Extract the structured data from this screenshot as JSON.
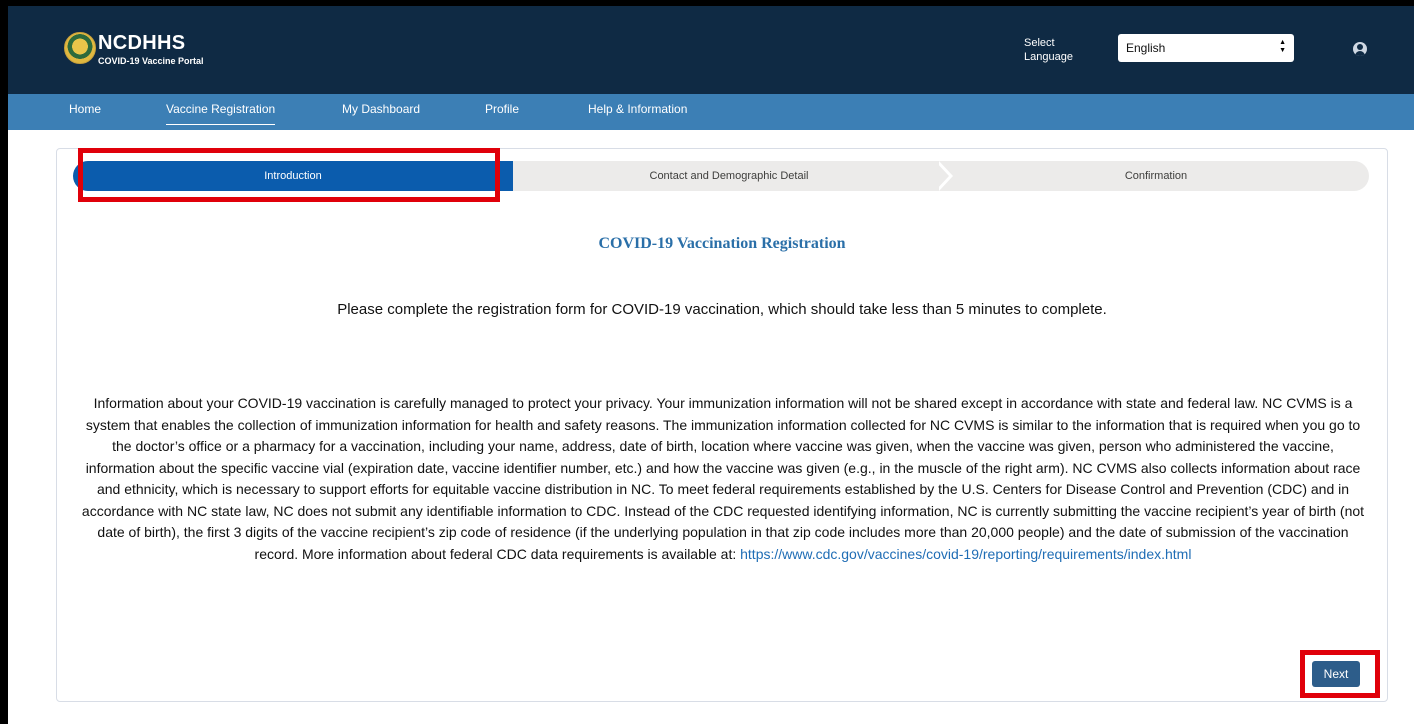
{
  "header": {
    "brand_title": "NCDHHS",
    "brand_subtitle": "COVID-19 Vaccine Portal",
    "language_label": "Select Language",
    "language_value": "English",
    "user_icon": "user-avatar-icon"
  },
  "nav": {
    "items": [
      {
        "label": "Home"
      },
      {
        "label": "Vaccine Registration"
      },
      {
        "label": "My Dashboard"
      },
      {
        "label": "Profile"
      },
      {
        "label": "Help & Information"
      }
    ],
    "active_index": 1
  },
  "path": {
    "steps": [
      {
        "label": "Introduction",
        "state": "current"
      },
      {
        "label": "Contact and Demographic Detail",
        "state": "upcoming"
      },
      {
        "label": "Confirmation",
        "state": "upcoming"
      }
    ]
  },
  "main": {
    "title": "COVID-19 Vaccination Registration",
    "intro": "Please complete the registration form for COVID-19 vaccination, which should take less than 5 minutes to complete.",
    "privacy_text": "Information about your COVID-19 vaccination is carefully managed to protect your privacy. Your immunization information will not be shared except in accordance with state and federal law. NC CVMS is a system that enables the collection of immunization information for health and safety reasons. The immunization information collected for NC CVMS is similar to the information that is required when you go to the doctor’s office or a pharmacy for a vaccination, including your name, address, date of birth, location where vaccine was given, when the vaccine was given, person who administered the vaccine, information about the specific vaccine vial (expiration date, vaccine identifier number, etc.) and how the vaccine was given (e.g., in the muscle of the right arm). NC CVMS also collects information about race and ethnicity, which is necessary to support efforts for equitable vaccine distribution in NC.  To meet federal requirements established by the U.S. Centers for Disease Control and   Prevention (CDC) and in accordance with NC state law, NC does not submit any identifiable information to CDC. Instead of the CDC requested identifying information, NC is currently submitting the vaccine recipient’s year of birth (not date of birth), the first 3 digits of the vaccine recipient’s zip code of residence (if the underlying population in that zip code includes more than 20,000 people) and the date of submission of the vaccination record. More information about federal CDC data requirements is available at: ",
    "privacy_link": "https://www.cdc.gov/vaccines/covid-19/reporting/requirements/index.html",
    "next_label": "Next"
  },
  "colors": {
    "header_bg": "#0f2a44",
    "nav_bg": "#3c7fb5",
    "step_active": "#0b5cad",
    "highlight": "#e0000a",
    "link": "#1f6db5"
  }
}
